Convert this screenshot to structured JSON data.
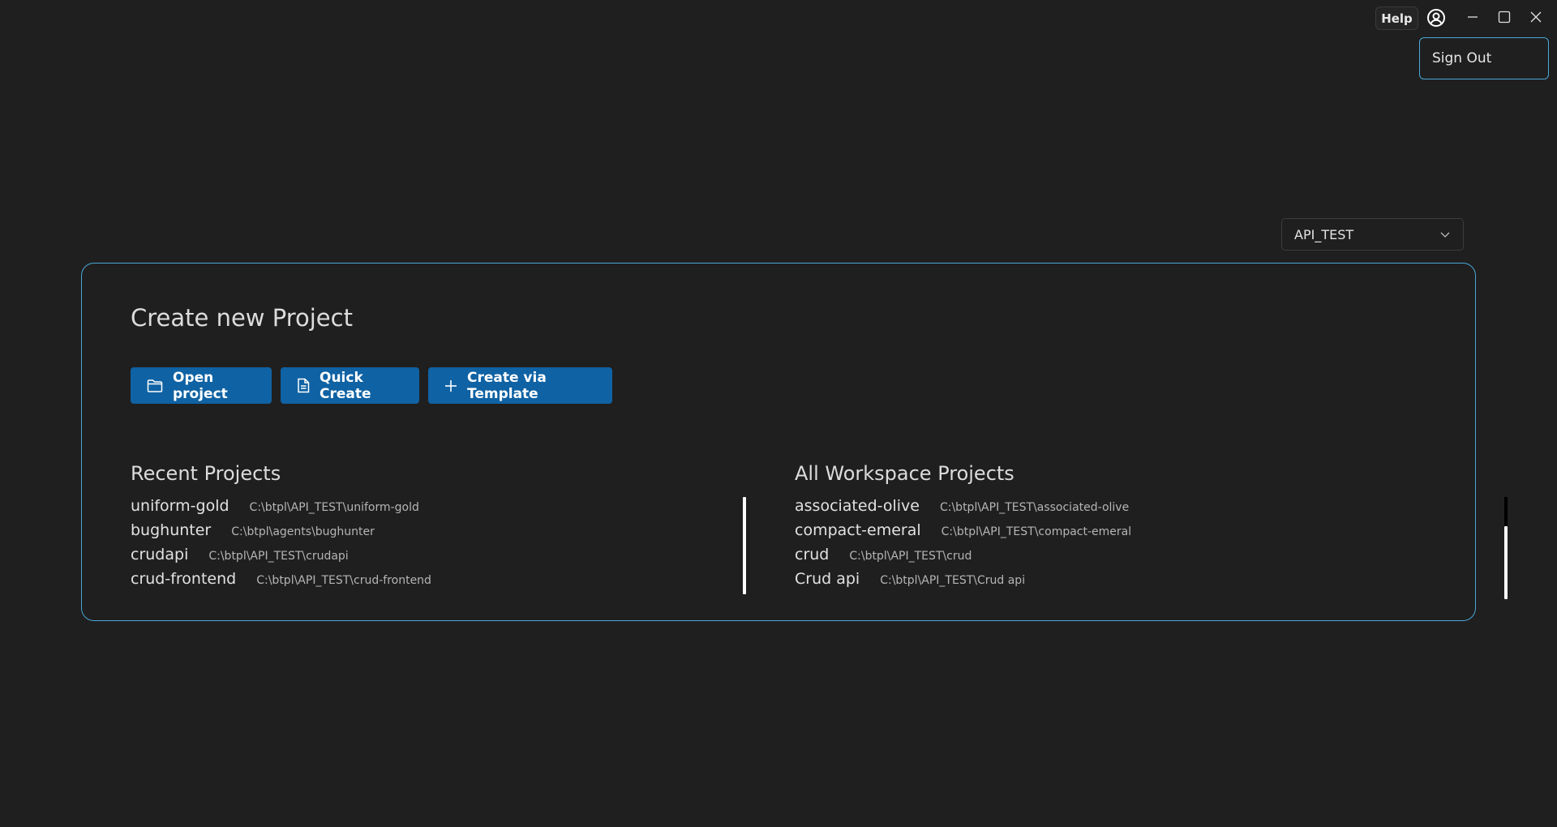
{
  "titlebar": {
    "help_label": "Help",
    "user_icon": "user-circle-icon",
    "minimize_icon": "minimize-icon",
    "maximize_icon": "maximize-icon",
    "close_icon": "close-icon"
  },
  "user_menu": {
    "items": [
      {
        "label": "Sign Out"
      }
    ]
  },
  "workspace_select": {
    "value": "API_TEST",
    "icon": "chevron-down-icon"
  },
  "card": {
    "title": "Create new Project",
    "actions": [
      {
        "label": "Open project",
        "icon": "folder-icon"
      },
      {
        "label": "Quick Create",
        "icon": "document-icon"
      },
      {
        "label": "Create via Template",
        "icon": "plus-icon"
      }
    ],
    "recent": {
      "title": "Recent Projects",
      "items": [
        {
          "name": "uniform-gold",
          "path": "C:\\btpl\\API_TEST\\uniform-gold"
        },
        {
          "name": "bughunter",
          "path": "C:\\btpl\\agents\\bughunter"
        },
        {
          "name": "crudapi",
          "path": "C:\\btpl\\API_TEST\\crudapi"
        },
        {
          "name": "crud-frontend",
          "path": "C:\\btpl\\API_TEST\\crud-frontend"
        }
      ]
    },
    "all": {
      "title": "All Workspace Projects",
      "items": [
        {
          "name": "associated-olive",
          "path": "C:\\btpl\\API_TEST\\associated-olive"
        },
        {
          "name": "compact-emeral",
          "path": "C:\\btpl\\API_TEST\\compact-emeral"
        },
        {
          "name": "crud",
          "path": "C:\\btpl\\API_TEST\\crud"
        },
        {
          "name": "Crud api",
          "path": "C:\\btpl\\API_TEST\\Crud api"
        }
      ]
    }
  },
  "colors": {
    "background": "#1f1f1f",
    "accent_border": "#4aa8d8",
    "button_bg": "#0f62a3"
  }
}
